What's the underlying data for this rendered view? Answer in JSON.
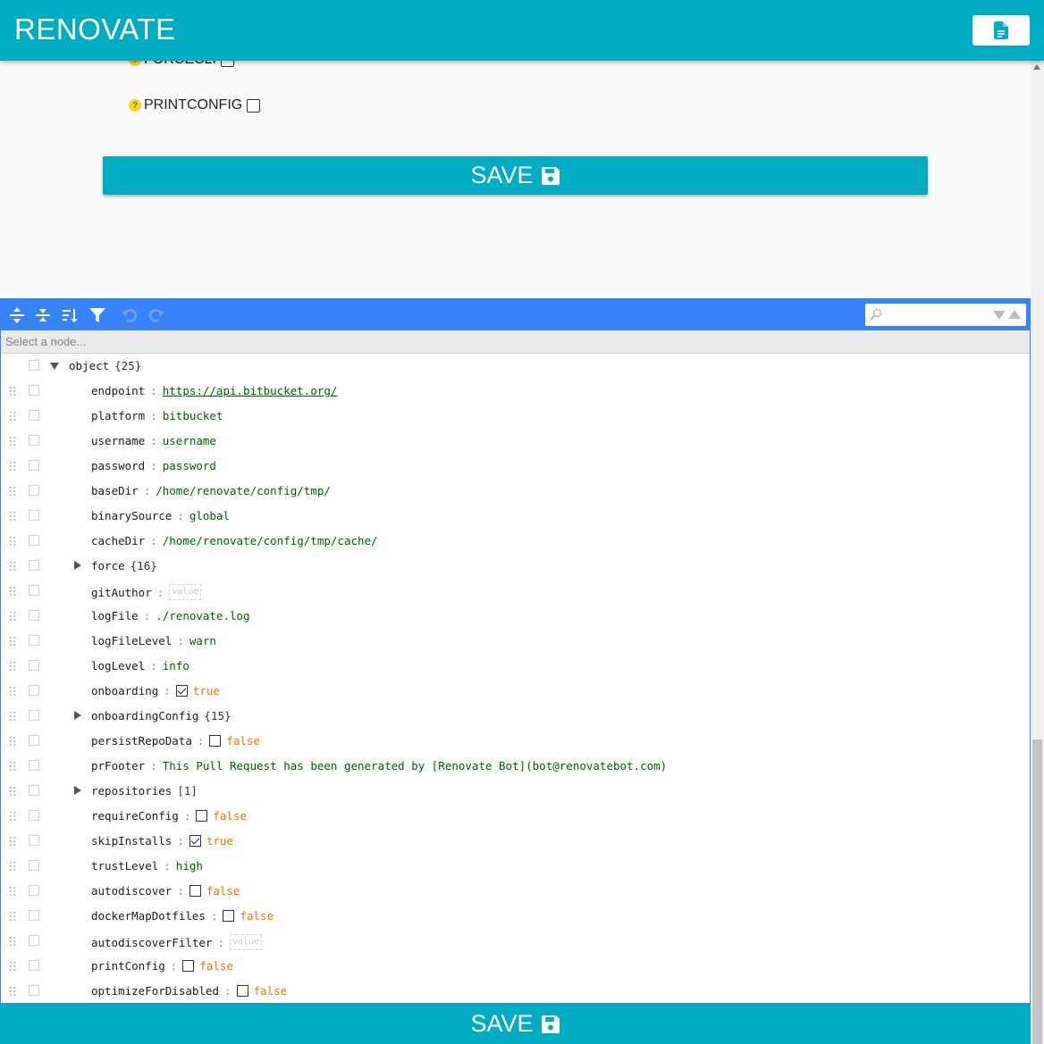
{
  "app": {
    "title": "RENOVATE"
  },
  "form": {
    "options": [
      {
        "label": "FORCECLI"
      },
      {
        "label": "PRINTCONFIG"
      }
    ],
    "save_label": "SAVE"
  },
  "editor": {
    "search_placeholder": "",
    "nav_placeholder": "Select a node...",
    "root": {
      "label": "object",
      "count": "{25}"
    },
    "rows": [
      {
        "key": "endpoint",
        "type": "url",
        "value": "https://api.bitbucket.org/"
      },
      {
        "key": "platform",
        "type": "string",
        "value": "bitbucket"
      },
      {
        "key": "username",
        "type": "string",
        "value": "username"
      },
      {
        "key": "password",
        "type": "string",
        "value": "password"
      },
      {
        "key": "baseDir",
        "type": "string",
        "value": "/home/renovate/config/tmp/"
      },
      {
        "key": "binarySource",
        "type": "string",
        "value": "global"
      },
      {
        "key": "cacheDir",
        "type": "string",
        "value": "/home/renovate/config/tmp/cache/"
      },
      {
        "key": "force",
        "type": "object",
        "count": "{16}"
      },
      {
        "key": "gitAuthor",
        "type": "empty",
        "placeholder": "value"
      },
      {
        "key": "logFile",
        "type": "string",
        "value": "./renovate.log"
      },
      {
        "key": "logFileLevel",
        "type": "string",
        "value": "warn"
      },
      {
        "key": "logLevel",
        "type": "string",
        "value": "info"
      },
      {
        "key": "onboarding",
        "type": "bool",
        "checked": true,
        "value": "true"
      },
      {
        "key": "onboardingConfig",
        "type": "object",
        "count": "{15}"
      },
      {
        "key": "persistRepoData",
        "type": "bool",
        "checked": false,
        "value": "false"
      },
      {
        "key": "prFooter",
        "type": "string",
        "value": "This Pull Request has been generated by [Renovate Bot](bot@renovatebot.com)"
      },
      {
        "key": "repositories",
        "type": "object",
        "count": "[1]"
      },
      {
        "key": "requireConfig",
        "type": "bool",
        "checked": false,
        "value": "false"
      },
      {
        "key": "skipInstalls",
        "type": "bool",
        "checked": true,
        "value": "true"
      },
      {
        "key": "trustLevel",
        "type": "string",
        "value": "high"
      },
      {
        "key": "autodiscover",
        "type": "bool",
        "checked": false,
        "value": "false"
      },
      {
        "key": "dockerMapDotfiles",
        "type": "bool",
        "checked": false,
        "value": "false"
      },
      {
        "key": "autodiscoverFilter",
        "type": "empty",
        "placeholder": "value"
      },
      {
        "key": "printConfig",
        "type": "bool",
        "checked": false,
        "value": "false"
      },
      {
        "key": "optimizeForDisabled",
        "type": "bool",
        "checked": false,
        "value": "false"
      }
    ]
  },
  "colors": {
    "brand": "#00acc1",
    "editor_menu": "#3883fa",
    "string_value": "#006000",
    "bool_value": "#ee7300"
  },
  "icons": {
    "header_button": "file-document-icon",
    "save": "floppy-disk-icon"
  }
}
